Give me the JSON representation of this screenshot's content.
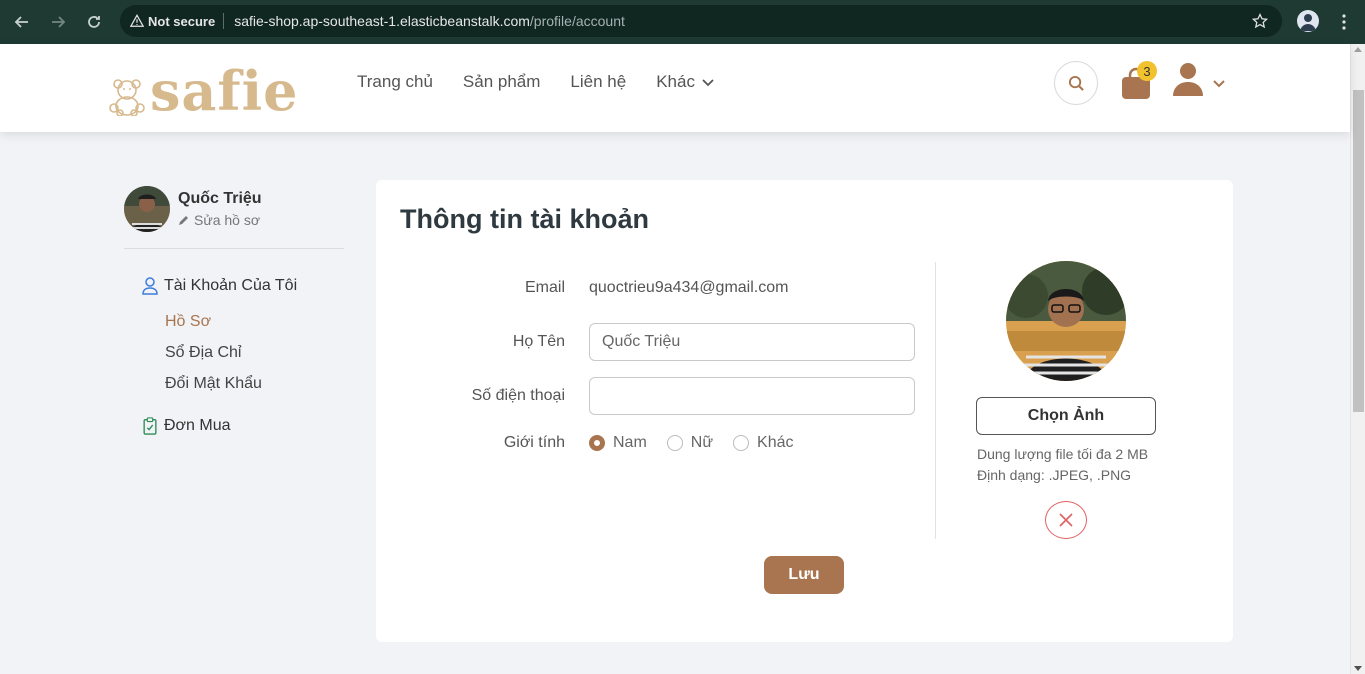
{
  "browser": {
    "security_label": "Not secure",
    "url_host": "safie-shop.ap-southeast-1.elasticbeanstalk.com",
    "url_path": "/profile/account"
  },
  "header": {
    "logo_text": "safie",
    "nav": [
      {
        "label": "Trang chủ"
      },
      {
        "label": "Sản phẩm"
      },
      {
        "label": "Liên hệ"
      },
      {
        "label": "Khác"
      }
    ],
    "cart_count": "3",
    "colors": {
      "brand": "#a87550",
      "badge": "#f2c22e"
    }
  },
  "sidebar": {
    "user_name": "Quốc Triệu",
    "edit_label": "Sửa hồ sơ",
    "account_heading": "Tài Khoản Của Tôi",
    "account_items": [
      {
        "label": "Hồ Sơ",
        "active": true
      },
      {
        "label": "Sổ Địa Chỉ"
      },
      {
        "label": "Đổi Mật Khẩu"
      }
    ],
    "orders_heading": "Đơn Mua"
  },
  "account": {
    "title": "Thông tin tài khoản",
    "email_label": "Email",
    "email_value": "quoctrieu9a434@gmail.com",
    "name_label": "Họ Tên",
    "name_value": "Quốc Triệu",
    "phone_label": "Số điện thoại",
    "phone_value": "",
    "gender_label": "Giới tính",
    "gender_options": [
      {
        "label": "Nam",
        "selected": true
      },
      {
        "label": "Nữ",
        "selected": false
      },
      {
        "label": "Khác",
        "selected": false
      }
    ],
    "choose_image_label": "Chọn Ảnh",
    "file_size_hint": "Dung lượng file tối đa 2 MB",
    "file_format_hint": "Định dạng: .JPEG, .PNG",
    "save_label": "Lưu"
  }
}
